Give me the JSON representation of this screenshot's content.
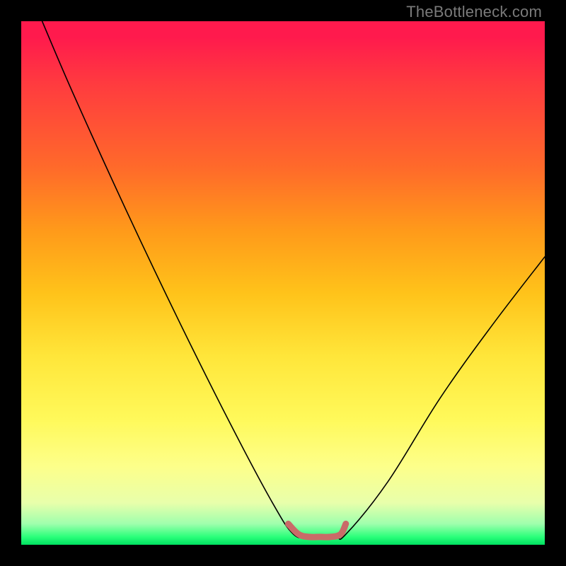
{
  "watermark": "TheBottleneck.com",
  "chart_data": {
    "type": "line",
    "title": "",
    "xlabel": "",
    "ylabel": "",
    "xlim": [
      0,
      100
    ],
    "ylim": [
      0,
      100
    ],
    "series": [
      {
        "name": "bottleneck-curve",
        "x": [
          4,
          10,
          20,
          30,
          40,
          48,
          52,
          55,
          60,
          62,
          70,
          80,
          90,
          100
        ],
        "values": [
          100,
          86,
          64,
          43,
          23,
          8,
          2,
          1.5,
          1.5,
          2,
          12,
          28,
          42,
          55
        ]
      },
      {
        "name": "optimal-range-marker",
        "x": [
          51,
          53,
          55,
          57,
          59,
          61,
          62
        ],
        "values": [
          4,
          2,
          1.5,
          1.5,
          1.5,
          2,
          4
        ]
      }
    ],
    "colors": {
      "curve": "#000000",
      "marker": "#c96b68",
      "background_top": "#ff1a4d",
      "background_mid": "#ffe63a",
      "background_bottom": "#00e060"
    }
  }
}
